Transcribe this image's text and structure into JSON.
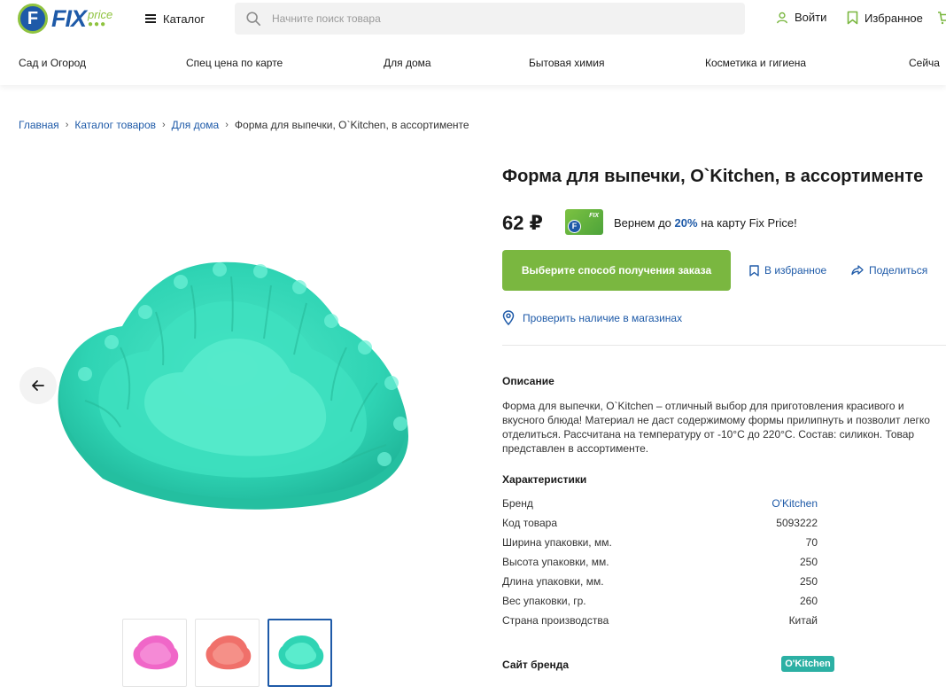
{
  "header": {
    "logo": {
      "letter": "F",
      "text": "FIX",
      "sub": "price",
      "dots": "●●●"
    },
    "catalog_label": "Каталог",
    "search_placeholder": "Начните поиск товара",
    "login_label": "Войти",
    "favorites_label": "Избранное"
  },
  "nav": {
    "items": [
      {
        "label": "Сад и Огород"
      },
      {
        "label": "Спец цена по карте"
      },
      {
        "label": "Для дома"
      },
      {
        "label": "Бытовая химия"
      },
      {
        "label": "Косметика и гигиена"
      },
      {
        "label": "Сейча"
      }
    ]
  },
  "breadcrumb": {
    "items": [
      "Главная",
      "Каталог товаров",
      "Для дома"
    ],
    "current": "Форма для выпечки, O`Kitchen, в ассортименте",
    "separator": "›"
  },
  "product": {
    "title": "Форма для выпечки, O`Kitchen, в ассортименте",
    "price": "62 ₽",
    "card": {
      "letter": "F",
      "brand": "FIX"
    },
    "cashback": {
      "prefix": "Вернем до",
      "percent": "20%",
      "suffix": "на карту Fix Price!"
    },
    "order_button": "Выберите способ получения заказа",
    "to_favorites": "В избранное",
    "share": "Поделиться",
    "availability": "Проверить наличие в магазинах",
    "image_color": "#2fd4b4",
    "thumbnails": [
      {
        "color": "#f067c8"
      },
      {
        "color": "#f0706a"
      },
      {
        "color": "#2fd4b4",
        "active": true
      }
    ]
  },
  "description": {
    "heading": "Описание",
    "text": "Форма для выпечки, O`Kitchen – отличный выбор для приготовления красивого и вкусного блюда! Материал не даст содержимому формы прилипнуть и позволит легко отделиться. Рассчитана на температуру от -10°C до 220°C. Состав: силикон. Товар представлен в ассортименте."
  },
  "specs": {
    "heading": "Характеристики",
    "rows": [
      {
        "key": "Бренд",
        "value": "O'Kitchen",
        "link": true
      },
      {
        "key": "Код товара",
        "value": "5093222"
      },
      {
        "key": "Ширина упаковки, мм.",
        "value": "70"
      },
      {
        "key": "Высота упаковки, мм.",
        "value": "250"
      },
      {
        "key": "Длина упаковки, мм.",
        "value": "250"
      },
      {
        "key": "Вес упаковки, гр.",
        "value": "260"
      },
      {
        "key": "Страна производства",
        "value": "Китай"
      }
    ]
  },
  "brand_site": {
    "heading": "Сайт бренда",
    "logo_text": "O'Kitchen"
  },
  "colors": {
    "brand_blue": "#1e5aa8",
    "brand_green": "#7ab740"
  }
}
